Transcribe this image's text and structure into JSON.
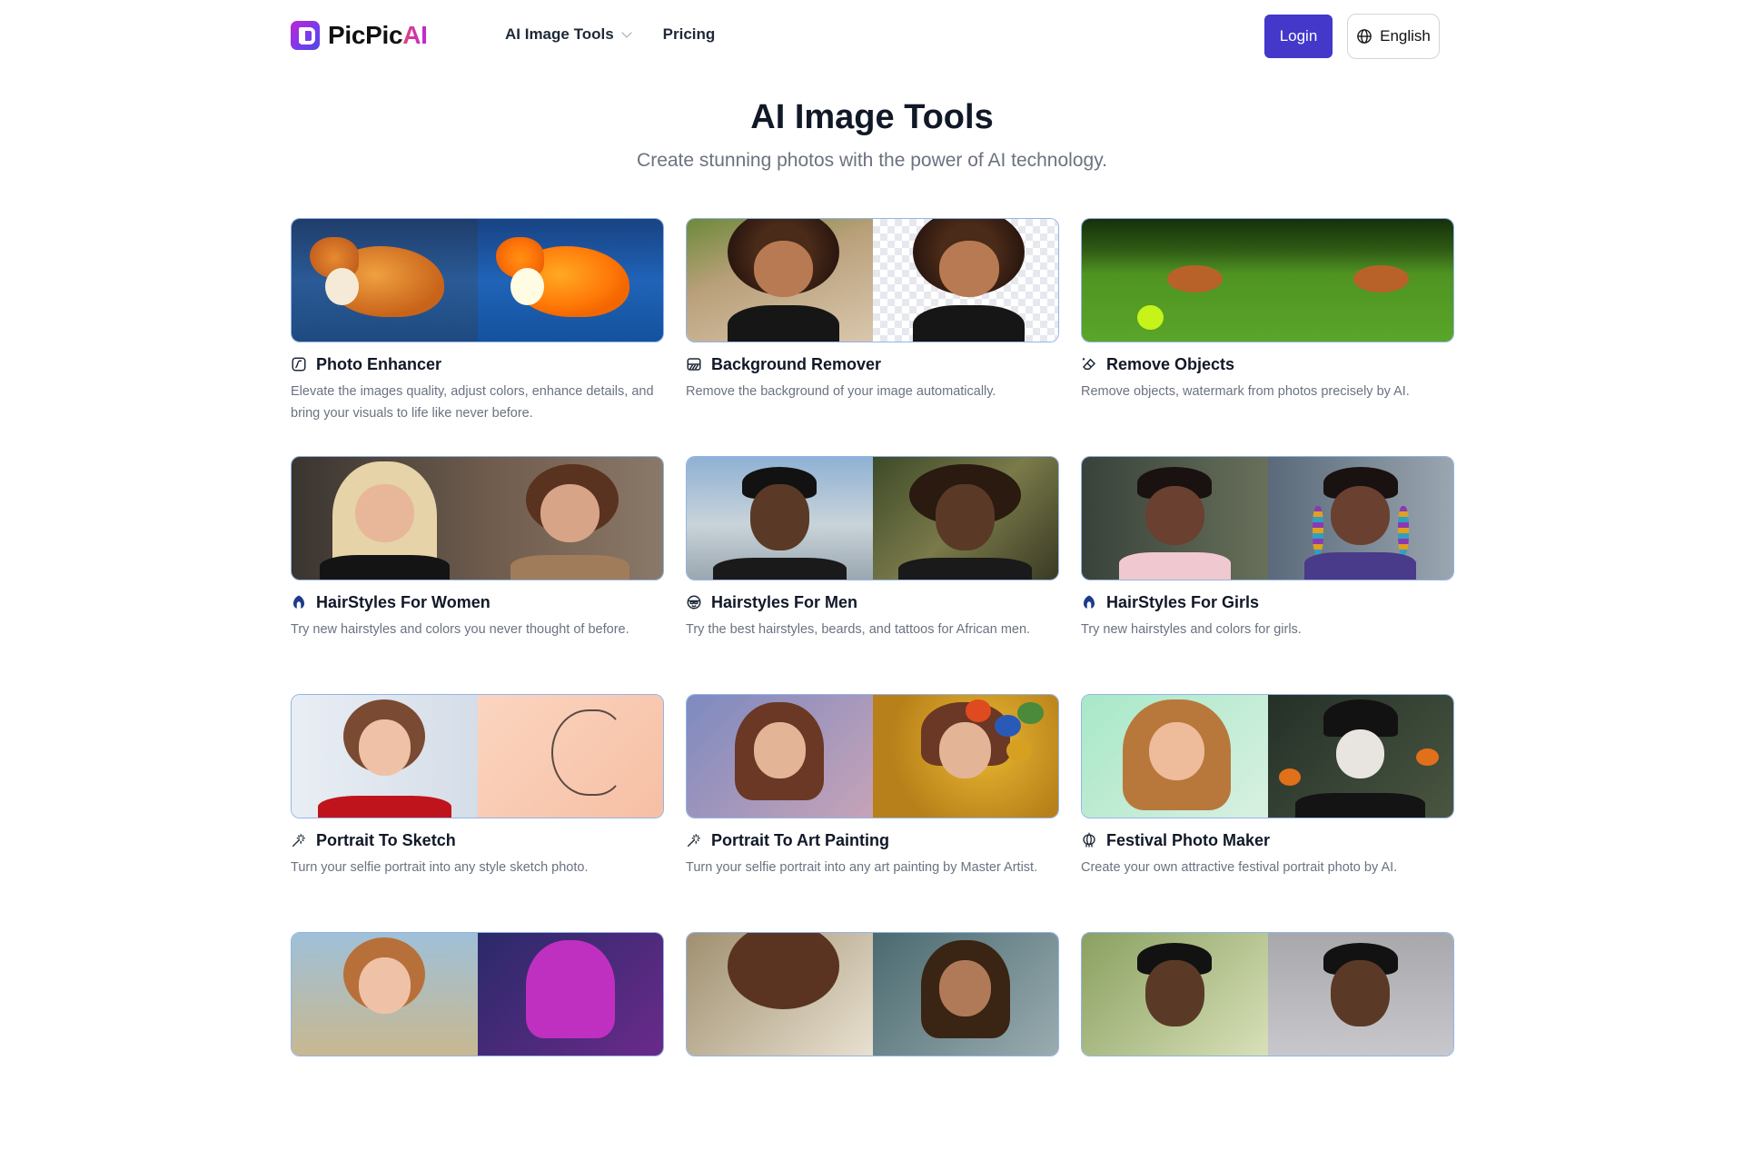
{
  "header": {
    "brand": {
      "name_main": "PicPic",
      "name_accent": "AI",
      "logo_icon": "picpic-logo-icon"
    },
    "nav": [
      {
        "label": "AI Image Tools",
        "has_dropdown": true
      },
      {
        "label": "Pricing",
        "has_dropdown": false
      }
    ],
    "login_label": "Login",
    "language": {
      "label": "English",
      "icon": "globe-icon"
    }
  },
  "hero": {
    "title": "AI Image Tools",
    "subtitle": "Create stunning photos with the power of AI technology."
  },
  "colors": {
    "primary": "#4338ca",
    "title_text": "#111827",
    "body_text": "#6b7280",
    "card_border": "#93b4e8"
  },
  "tools": [
    {
      "icon": "enhance-curve-icon",
      "title": "Photo Enhancer",
      "description": "Elevate the images quality, adjust colors, enhance details, and bring your visuals to life like never before."
    },
    {
      "icon": "background-remove-icon",
      "title": "Background Remover",
      "description": "Remove the background of your image automatically."
    },
    {
      "icon": "eraser-sparkle-icon",
      "title": "Remove Objects",
      "description": "Remove objects, watermark from photos precisely by AI."
    },
    {
      "icon": "hair-icon",
      "title": "HairStyles For Women",
      "description": "Try new hairstyles and colors you never thought of before."
    },
    {
      "icon": "man-face-icon",
      "title": "Hairstyles For Men",
      "description": "Try the best hairstyles, beards, and tattoos for African men."
    },
    {
      "icon": "hair-icon",
      "title": "HairStyles For Girls",
      "description": "Try new hairstyles and colors for girls."
    },
    {
      "icon": "magic-wand-icon",
      "title": "Portrait To Sketch",
      "description": "Turn your selfie portrait into any style sketch photo."
    },
    {
      "icon": "magic-wand-icon",
      "title": "Portrait To Art Painting",
      "description": "Turn your selfie portrait into any art painting by Master Artist."
    },
    {
      "icon": "lantern-icon",
      "title": "Festival Photo Maker",
      "description": "Create your own attractive festival portrait photo by AI."
    }
  ]
}
